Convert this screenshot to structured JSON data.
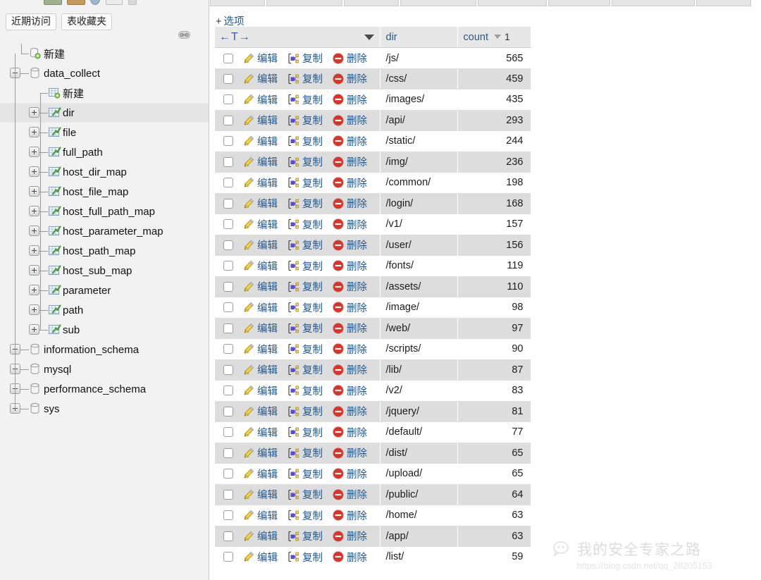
{
  "sidebar": {
    "tabs": [
      {
        "label": "近期访问",
        "name": "recent-tab"
      },
      {
        "label": "表收藏夹",
        "name": "favorites-tab"
      }
    ],
    "link_icon": "chain-link-icon",
    "tree": [
      {
        "label": "新建",
        "type": "new-db",
        "depth": 1,
        "toggle": "none",
        "icon": "new-database-icon",
        "selected": false
      },
      {
        "label": "data_collect",
        "type": "database",
        "depth": 0,
        "toggle": "minus",
        "icon": "database-icon",
        "selected": false
      },
      {
        "label": "新建",
        "type": "new-table",
        "depth": 2,
        "toggle": "none",
        "icon": "new-table-icon",
        "selected": false
      },
      {
        "label": "dir",
        "type": "table",
        "depth": 2,
        "toggle": "plus",
        "icon": "table-icon",
        "selected": true
      },
      {
        "label": "file",
        "type": "table",
        "depth": 2,
        "toggle": "plus",
        "icon": "table-icon",
        "selected": false
      },
      {
        "label": "full_path",
        "type": "table",
        "depth": 2,
        "toggle": "plus",
        "icon": "table-icon",
        "selected": false
      },
      {
        "label": "host_dir_map",
        "type": "table",
        "depth": 2,
        "toggle": "plus",
        "icon": "table-icon",
        "selected": false
      },
      {
        "label": "host_file_map",
        "type": "table",
        "depth": 2,
        "toggle": "plus",
        "icon": "table-icon",
        "selected": false
      },
      {
        "label": "host_full_path_map",
        "type": "table",
        "depth": 2,
        "toggle": "plus",
        "icon": "table-icon",
        "selected": false
      },
      {
        "label": "host_parameter_map",
        "type": "table",
        "depth": 2,
        "toggle": "plus",
        "icon": "table-icon",
        "selected": false
      },
      {
        "label": "host_path_map",
        "type": "table",
        "depth": 2,
        "toggle": "plus",
        "icon": "table-icon",
        "selected": false
      },
      {
        "label": "host_sub_map",
        "type": "table",
        "depth": 2,
        "toggle": "plus",
        "icon": "table-icon",
        "selected": false
      },
      {
        "label": "parameter",
        "type": "table",
        "depth": 2,
        "toggle": "plus",
        "icon": "table-icon",
        "selected": false
      },
      {
        "label": "path",
        "type": "table",
        "depth": 2,
        "toggle": "plus",
        "icon": "table-icon",
        "selected": false
      },
      {
        "label": "sub",
        "type": "table",
        "depth": 2,
        "toggle": "plus",
        "icon": "table-icon",
        "selected": false
      },
      {
        "label": "information_schema",
        "type": "database",
        "depth": 0,
        "toggle": "plus",
        "icon": "database-icon",
        "selected": false
      },
      {
        "label": "mysql",
        "type": "database",
        "depth": 0,
        "toggle": "plus",
        "icon": "database-icon",
        "selected": false
      },
      {
        "label": "performance_schema",
        "type": "database",
        "depth": 0,
        "toggle": "plus",
        "icon": "database-icon",
        "selected": false
      },
      {
        "label": "sys",
        "type": "database",
        "depth": 0,
        "toggle": "plus",
        "icon": "database-icon",
        "selected": false
      }
    ]
  },
  "main": {
    "options_label": "选项",
    "options_plus": "+",
    "tab_count": 8,
    "table": {
      "sort_control": "←T→",
      "header_caret_icon": "chevron-down-icon",
      "columns": [
        {
          "key": "actions",
          "label": ""
        },
        {
          "key": "dir",
          "label": "dir"
        },
        {
          "key": "count",
          "label": "count"
        }
      ],
      "count_sort_caret_icon": "sort-desc-icon",
      "count_sort_order": "1",
      "row_actions": [
        {
          "label": "编辑",
          "icon": "pencil-icon",
          "name": "edit-link"
        },
        {
          "label": "复制",
          "icon": "copy-icon",
          "name": "copy-link"
        },
        {
          "label": "删除",
          "icon": "delete-icon",
          "name": "delete-link"
        }
      ],
      "rows": [
        {
          "dir": "/js/",
          "count": "565"
        },
        {
          "dir": "/css/",
          "count": "459"
        },
        {
          "dir": "/images/",
          "count": "435"
        },
        {
          "dir": "/api/",
          "count": "293"
        },
        {
          "dir": "/static/",
          "count": "244"
        },
        {
          "dir": "/img/",
          "count": "236"
        },
        {
          "dir": "/common/",
          "count": "198"
        },
        {
          "dir": "/login/",
          "count": "168"
        },
        {
          "dir": "/v1/",
          "count": "157"
        },
        {
          "dir": "/user/",
          "count": "156"
        },
        {
          "dir": "/fonts/",
          "count": "119"
        },
        {
          "dir": "/assets/",
          "count": "110"
        },
        {
          "dir": "/image/",
          "count": "98"
        },
        {
          "dir": "/web/",
          "count": "97"
        },
        {
          "dir": "/scripts/",
          "count": "90"
        },
        {
          "dir": "/lib/",
          "count": "87"
        },
        {
          "dir": "/v2/",
          "count": "83"
        },
        {
          "dir": "/jquery/",
          "count": "81"
        },
        {
          "dir": "/default/",
          "count": "77"
        },
        {
          "dir": "/dist/",
          "count": "65"
        },
        {
          "dir": "/upload/",
          "count": "65"
        },
        {
          "dir": "/public/",
          "count": "64"
        },
        {
          "dir": "/home/",
          "count": "63"
        },
        {
          "dir": "/app/",
          "count": "63"
        },
        {
          "dir": "/list/",
          "count": "59"
        }
      ]
    }
  },
  "watermark": {
    "icon": "wechat-icon",
    "title": "我的安全专家之路",
    "url": "https://blog.csdn.net/qq_28205153"
  },
  "colors": {
    "link": "#235a90",
    "sidebar_bg": "#f2f2f2",
    "row_even": "#dddddd",
    "row_odd": "#ffffff",
    "header_bg": "#e7e7e7",
    "selected_row": "#e4e4e4",
    "edit_icon": "#e8b923",
    "copy_icon": "#5b4bd6",
    "delete_icon": "#cc2b2b"
  }
}
